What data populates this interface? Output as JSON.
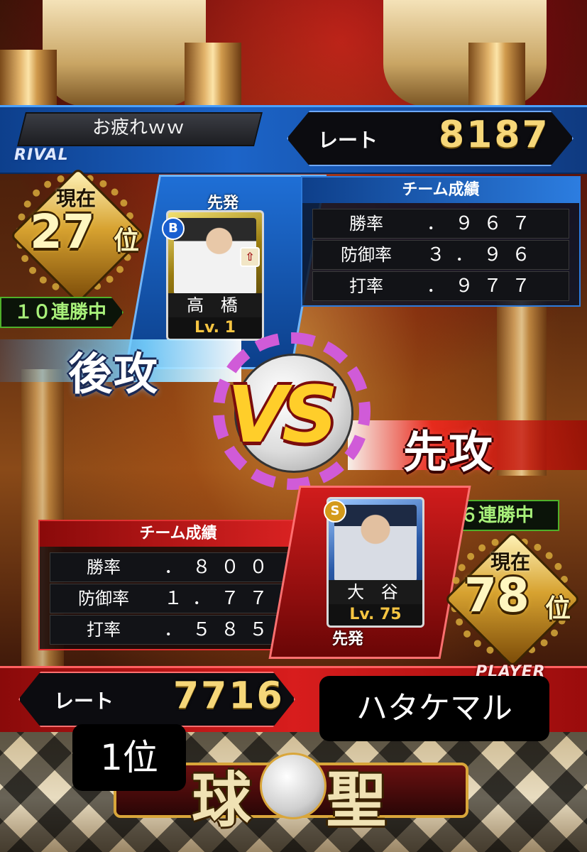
{
  "rival": {
    "tag": "RIVAL",
    "name": "お疲れｗｗ",
    "rate_label": "レート",
    "rate_value": "8187",
    "rank_current": "現在",
    "rank_number": "27",
    "rank_suffix": "位",
    "streak": "１０連勝中",
    "attack": "後攻",
    "starter_label": "先発",
    "card": {
      "rarity_badge": "B",
      "name": "高 橋",
      "level": "Lv. 1"
    },
    "stats_title": "チーム成績",
    "stats": [
      {
        "label": "勝率",
        "value": "．９６７"
      },
      {
        "label": "防御率",
        "value": "３．９６"
      },
      {
        "label": "打率",
        "value": "．９７７"
      }
    ]
  },
  "vs_label": "VS",
  "player": {
    "tag": "PLAYER",
    "name": "ハタケマル",
    "rate_label": "レート",
    "rate_value": "7716",
    "rank_current": "現在",
    "rank_number": "78",
    "rank_suffix": "位",
    "streak": "６連勝中",
    "attack": "先攻",
    "starter_label": "先発",
    "card": {
      "rarity_badge": "S",
      "name": "大 谷",
      "level": "Lv. 75"
    },
    "stats_title": "チーム成績",
    "stats": [
      {
        "label": "勝率",
        "value": "．８００"
      },
      {
        "label": "防御率",
        "value": "１．７７"
      },
      {
        "label": "打率",
        "value": "．５８５"
      }
    ]
  },
  "title_rank": "1位",
  "title_emblem": {
    "left": "球",
    "right": "聖"
  },
  "colors": {
    "rival_band": "#1c64c8",
    "player_band": "#d81d1d",
    "gold": "#f6d779",
    "streak_green": "#a8f07a"
  }
}
